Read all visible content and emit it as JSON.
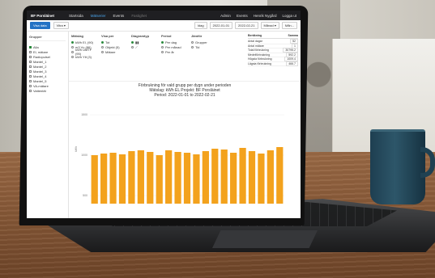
{
  "app": {
    "brand": "BF Porsläinet",
    "nav": [
      {
        "label": "Startsida",
        "state": "normal"
      },
      {
        "label": "Mätserier",
        "state": "active"
      },
      {
        "label": "Events",
        "state": "normal"
      },
      {
        "label": "Fastighet",
        "state": "muted"
      }
    ],
    "nav_right": [
      "Admin",
      "Events",
      "Henrik Nygård",
      "Logga ut"
    ]
  },
  "toolbar": {
    "primary_label": "Visa data",
    "view_label": "Vitra ▾",
    "date_from": "2022-01-01",
    "date_to": "2022-02-21",
    "period_label": "Månad ▾",
    "today_label": "Idag",
    "extra_label": "Mån..."
  },
  "sidebar": {
    "heading": "Grupper",
    "items": [
      {
        "label": "Alla",
        "checked": true
      },
      {
        "label": "El, mätare",
        "checked": false
      },
      {
        "label": "Radiopulsel",
        "checked": false
      },
      {
        "label": "Mantel_1",
        "checked": false
      },
      {
        "label": "Mantel_2",
        "checked": false
      },
      {
        "label": "Mantel_3",
        "checked": false
      },
      {
        "label": "Mantel_4",
        "checked": false
      },
      {
        "label": "Mantel_5",
        "checked": false
      },
      {
        "label": "VA-mätare",
        "checked": false
      },
      {
        "label": "Vattentät",
        "checked": false
      }
    ]
  },
  "filters": {
    "columns": [
      {
        "title": "Mätslag",
        "options": [
          {
            "label": "kWh El, (90)",
            "on": true
          },
          {
            "label": "m3 Vv (86)",
            "on": false
          },
          {
            "label": "kWh UMTF (95)",
            "on": false
          },
          {
            "label": "kWh Ytt (3)",
            "on": false
          }
        ]
      },
      {
        "title": "Visa per",
        "options": [
          {
            "label": "Tot",
            "on": true
          },
          {
            "label": "Objekt (5)",
            "on": false
          },
          {
            "label": "Mätare",
            "on": false
          }
        ]
      },
      {
        "title": "Diagramtyp",
        "options": [
          {
            "label": "▮▮",
            "on": true
          },
          {
            "label": "⟋",
            "on": false
          }
        ]
      },
      {
        "title": "Period",
        "options": [
          {
            "label": "Per dag",
            "on": true
          },
          {
            "label": "Per månad",
            "on": false
          },
          {
            "label": "Per år",
            "on": false
          }
        ]
      },
      {
        "title": "Jämför",
        "options": [
          {
            "label": "Grupper",
            "on": false
          },
          {
            "label": "Tid",
            "on": false
          }
        ]
      }
    ]
  },
  "stats": {
    "header_left": "Beräkning",
    "header_right": "Samma",
    "rows": [
      {
        "label": "Antal dagar",
        "value": "52"
      },
      {
        "label": "Antal mätare",
        "value": "1"
      },
      {
        "label": "Total förbrukning",
        "value": "30795.2"
      },
      {
        "label": "Medelförbrukning",
        "value": "592.2"
      },
      {
        "label": "Högsta förbrukning",
        "value": "1009.4"
      },
      {
        "label": "Lägsta förbrukning",
        "value": "466.7"
      }
    ]
  },
  "chart_title_lines": [
    "Förbrukning för vald grupp per dygn under perioden",
    "Mätslag: kWh EL    Projekt: BF Porsläinet",
    "Period: 2022-01-01 to 2022-02-21"
  ],
  "chart_data": {
    "type": "bar",
    "title": "Förbrukning för vald grupp per dygn under perioden",
    "ylabel": "kWh",
    "yticks": [
      "1500",
      "1000",
      "500"
    ],
    "ylim": [
      400,
      1600
    ],
    "bar_color": "#f3a21d",
    "values": [
      1000,
      1020,
      1030,
      1010,
      1050,
      1060,
      1040,
      1000,
      1060,
      1040,
      1030,
      1010,
      1050,
      1080,
      1070,
      1030,
      1090,
      1050,
      1020,
      1060,
      1100
    ]
  }
}
